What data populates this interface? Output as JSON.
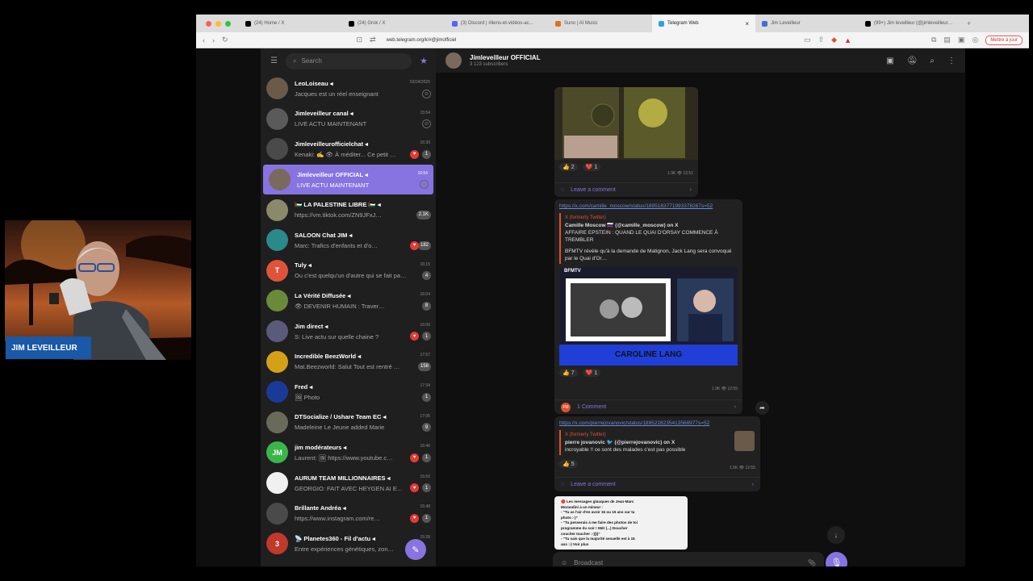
{
  "browser": {
    "tabs": [
      {
        "label": "(24) Home / X",
        "icon": "x-icon",
        "color": "#000000"
      },
      {
        "label": "(24) Grok / X",
        "icon": "x-icon",
        "color": "#000000"
      },
      {
        "label": "(3) Discord | #liens-et-vidéos-ac…",
        "icon": "discord-icon",
        "color": "#5865f2"
      },
      {
        "label": "Suno | AI Music",
        "icon": "suno-icon",
        "color": "#e07020"
      },
      {
        "label": "Telegram Web",
        "icon": "telegram-icon",
        "color": "#2aa3e0",
        "active": true
      },
      {
        "label": "Jim Leveilleur",
        "icon": "page-icon",
        "color": "#3b6fd6"
      },
      {
        "label": "(99+) Jim leveilleur (@jimleveilleur…",
        "icon": "x-icon",
        "color": "#000000"
      }
    ],
    "url": "web.telegram.org/k/#@jimofficiel",
    "update_label": "Mettre à jour"
  },
  "sidebar": {
    "search_placeholder": "Search",
    "chats": [
      {
        "name": "LeoLoiseau ◂",
        "preview": "Jacques est un réel enseignant",
        "time": "02/24/2025",
        "badge": "",
        "pin": true,
        "avatar": "#6b5a4a"
      },
      {
        "name": "Jimleveilleur canal ◂",
        "preview": "LIVE ACTU MAINTENANT",
        "time": "15:54",
        "badge": "",
        "pin": true,
        "avatar": "#5a5a5a"
      },
      {
        "name": "Jimleveilleurofficielchat ◂",
        "preview": "Kenaki: ✍ 👁 À méditer... Ce petit …",
        "time": "16:39",
        "badge": "1",
        "heart": "red",
        "avatar": "#4a4a4a"
      },
      {
        "name": "Jimleveilleur OFFICIAL ◂",
        "preview": "LIVE ACTU MAINTENANT",
        "time": "15:54",
        "badge": "",
        "pin": true,
        "selected": true,
        "avatar": "#7a6a5e"
      },
      {
        "name": "🇵🇸 LA PALESTINE LIBRE 🇵🇸 ◂",
        "preview": "https://vm.tiktok.com/ZN9JFxJ…",
        "time": "",
        "badge": "2.1K",
        "avatar": "#8a8a6a"
      },
      {
        "name": "SALOON Chat JIM ◂",
        "preview": "Marc: Trafics d'enfants et d'o…",
        "time": "",
        "badge": "182",
        "heart": "red",
        "avatar": "#2a8a8a"
      },
      {
        "name": "Tuly ◂",
        "preview": "Ou c'est quelqu'un d'autre qui se fait pa…",
        "time": "16:15",
        "badge": "4",
        "avatar": "#e0533b",
        "initial": "T"
      },
      {
        "name": "La Vérité Diffusée ◂",
        "preview": "👁 DEVENIR HUMAIN : Traver…",
        "time": "16:04",
        "badge": "8",
        "avatar": "#6a8a3a"
      },
      {
        "name": "Jim direct ◂",
        "preview": "S: Live actu sur quelle chaine ?",
        "time": "16:00",
        "badge": "1",
        "heart": "red",
        "avatar": "#5a5a7a"
      },
      {
        "name": "Incredible BeezWorld ◂",
        "preview": "Mat.Beezworld: Salut Tout est rentré …",
        "time": "17:57",
        "badge": "158",
        "avatar": "#d4a017"
      },
      {
        "name": "Fred ◂",
        "preview": "🖼 Photo",
        "time": "17:34",
        "badge": "1",
        "avatar": "#1a3a9a"
      },
      {
        "name": "DTSocialize / Ushare Team EC ◂",
        "preview": "Madeleine Le Jeune added Marie",
        "time": "17:05",
        "badge": "9",
        "avatar": "#6a6a5a"
      },
      {
        "name": "jim modérateurs ◂",
        "preview": "Laurent: 🖼 https://www.youtube.c…",
        "time": "16:46",
        "badge": "1",
        "heart": "red",
        "avatar": "#3bb54a",
        "initial": "JM"
      },
      {
        "name": "AURUM TEAM MILLIONNAIRES ◂",
        "preview": "GEORGIO: FAIT AVEC HEYGEN AI E…",
        "time": "15:50",
        "badge": "1",
        "heart": "red",
        "avatar": "#f0f0f0"
      },
      {
        "name": "Brillante Andréa ◂",
        "preview": "https://www.instagram.com/re…",
        "time": "15:48",
        "badge": "1",
        "heart": "red",
        "avatar": "#4a4a4a"
      },
      {
        "name": "📡 Planetes360 - Fil d'actu ◂",
        "preview": "Entre expériences génétiques, zon…",
        "time": "15:28",
        "badge": "",
        "avatar": "#c0392b",
        "initial": "3"
      }
    ]
  },
  "chat": {
    "title": "Jimleveilleur OFFICIAL",
    "subtitle": "3 123 subscribers",
    "messages": {
      "m1": {
        "likes": "2",
        "hearts": "1",
        "views": "1.9K",
        "time": "12:51",
        "comment": "Leave a comment"
      },
      "m2": {
        "link": "https://x.com/camille_moscow/status/1895183771993378267s=52",
        "source": "X (formerly Twitter)",
        "preview_title": "Camille Moscow 🇷🇺 (@camille_moscow) on X",
        "preview_body": "AFFAIRE EPSTEIN : QUAND LE QUAI D'ORSAY COMMENCE À TREMBLER",
        "preview_text": "BFMTV révèle qu'à la demande de Matignon, Jack Lang sera convoqué par le Quai d'Or…",
        "video_caption": "CAROLINE LANG",
        "video_logo": "BFMTV",
        "likes": "7",
        "hearts": "1",
        "views": "1.9K",
        "time": "12:55",
        "comment": "1 Comment"
      },
      "m3": {
        "link": "https://x.com/pierrejovanovic/status/1895228235413568977s=52",
        "source": "X (formerly Twitter)",
        "preview_title": "pierre jovanovic 🐦 (@pierrejovanovic) on X",
        "preview_body": "incroyable !! ce sont des malades c'est pas possible",
        "likes": "5",
        "views": "1.5K",
        "time": "12:55",
        "comment": "Leave a comment"
      },
      "m4": {
        "lines": [
          "🔴 Les messages glauques de Jean-Marc",
          "Morandini à un mineur :",
          "- \"Tu as l'air d'en avoir 16 ou 15 ans sur ta",
          "photo :-)\"",
          "- \"Tu penserais à me faire des photos de toi",
          "programme du soir ! Mdr (...) Doucher",
          "coucher toucher :-))))\"",
          "- \"Tu sais que la majorité sexuelle est à 15",
          "ans :-) Voir plus"
        ]
      }
    },
    "composer_placeholder": "Broadcast"
  },
  "webcam": {
    "name_tag": "JIM LEVEILLEUR"
  }
}
